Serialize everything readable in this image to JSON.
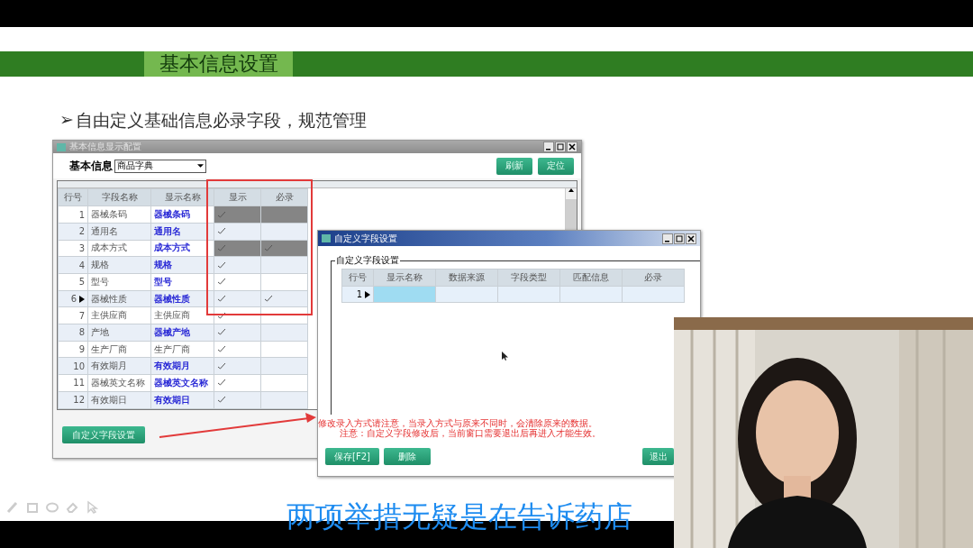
{
  "slide": {
    "title": "基本信息设置",
    "bullet_marker": "➢",
    "bullet": "自由定义基础信息必录字段，规范管理"
  },
  "main_window": {
    "title": "基本信息显示配置",
    "filter_label": "基本信息",
    "filter_value": "商品字典",
    "buttons": [
      "刷新",
      "定位"
    ],
    "columns": [
      "行号",
      "字段名称",
      "显示名称",
      "显示",
      "必录"
    ],
    "rows": [
      {
        "no": "1",
        "field": "器械条码",
        "display": "器械条码",
        "display_custom": true,
        "show": true,
        "required": false,
        "locked": true,
        "current": false
      },
      {
        "no": "2",
        "field": "通用名",
        "display": "通用名",
        "display_custom": true,
        "show": true,
        "required": false,
        "locked": false,
        "current": false
      },
      {
        "no": "3",
        "field": "成本方式",
        "display": "成本方式",
        "display_custom": true,
        "show": true,
        "required": true,
        "locked": true,
        "current": false
      },
      {
        "no": "4",
        "field": "规格",
        "display": "规格",
        "display_custom": true,
        "show": true,
        "required": false,
        "locked": false,
        "current": false
      },
      {
        "no": "5",
        "field": "型号",
        "display": "型号",
        "display_custom": true,
        "show": true,
        "required": false,
        "locked": false,
        "current": false
      },
      {
        "no": "6",
        "field": "器械性质",
        "display": "器械性质",
        "display_custom": true,
        "show": true,
        "required": true,
        "locked": false,
        "current": true
      },
      {
        "no": "7",
        "field": "主供应商",
        "display": "主供应商",
        "display_custom": false,
        "show": true,
        "required": false,
        "locked": false,
        "current": false
      },
      {
        "no": "8",
        "field": "产地",
        "display": "器械产地",
        "display_custom": true,
        "show": true,
        "required": false,
        "locked": false,
        "current": false
      },
      {
        "no": "9",
        "field": "生产厂商",
        "display": "生产厂商",
        "display_custom": false,
        "show": true,
        "required": false,
        "locked": false,
        "current": false
      },
      {
        "no": "10",
        "field": "有效期月",
        "display": "有效期月",
        "display_custom": true,
        "show": true,
        "required": false,
        "locked": false,
        "current": false
      },
      {
        "no": "11",
        "field": "器械英文名称",
        "display": "器械英文名称",
        "display_custom": true,
        "show": true,
        "required": false,
        "locked": false,
        "current": false
      },
      {
        "no": "12",
        "field": "有效期日",
        "display": "有效期日",
        "display_custom": true,
        "show": true,
        "required": false,
        "locked": false,
        "current": false
      }
    ],
    "footer_button": "自定义字段设置"
  },
  "dialog": {
    "title": "自定义字段设置",
    "group_label": "自定义字段设置",
    "columns": [
      "行号",
      "显示名称",
      "数据来源",
      "字段类型",
      "匹配信息",
      "必录"
    ],
    "rows": [
      {
        "no": "1",
        "current": true
      }
    ],
    "notes": [
      "修改录入方式请注意，当录入方式与原来不同时，会清除原来的数据。",
      "注意：自定义字段修改后，当前窗口需要退出后再进入才能生效。"
    ],
    "buttons": [
      "保存[F2]",
      "删除",
      "退出"
    ]
  },
  "caption": "两项举措无疑是在告诉药店"
}
